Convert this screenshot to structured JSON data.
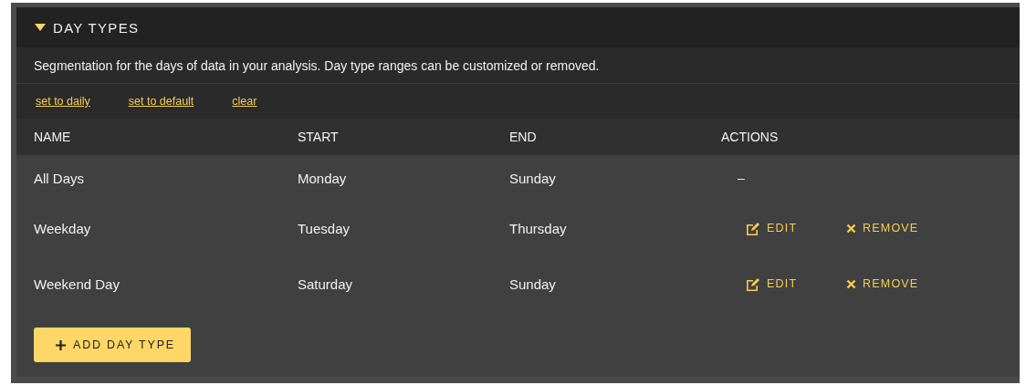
{
  "section": {
    "title": "DAY TYPES",
    "expanded": true
  },
  "description": "Segmentation for the days of data in your analysis. Day type ranges can be customized or removed.",
  "links": [
    "set to daily",
    "set to default",
    "clear"
  ],
  "table": {
    "columns": [
      "NAME",
      "START",
      "END",
      "ACTIONS"
    ],
    "rows": [
      {
        "kind": "fixed",
        "name": "All Days",
        "start": "Monday",
        "end": "Sunday",
        "actions_text": "–"
      },
      {
        "kind": "editable",
        "name": "Weekday",
        "start": "Tuesday",
        "end": "Thursday",
        "edit_label": "EDIT",
        "remove_label": "REMOVE"
      },
      {
        "kind": "editable",
        "name": "Weekend Day",
        "start": "Saturday",
        "end": "Sunday",
        "edit_label": "EDIT",
        "remove_label": "REMOVE"
      }
    ]
  },
  "add_button": {
    "label": "ADD DAY TYPE"
  }
}
